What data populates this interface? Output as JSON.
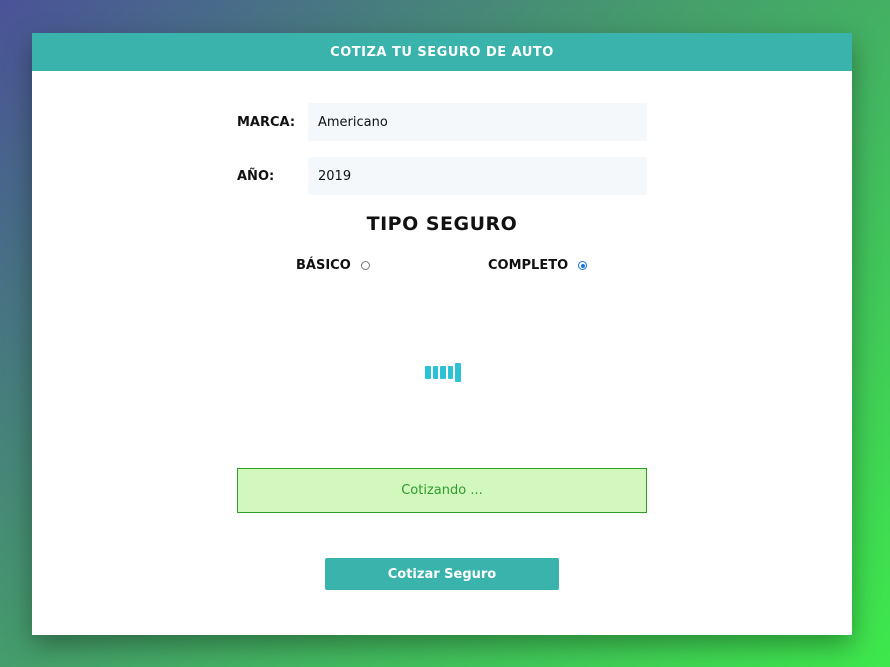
{
  "header": {
    "title": "COTIZA TU SEGURO DE AUTO"
  },
  "form": {
    "marca": {
      "label": "MARCA:",
      "value": "Americano"
    },
    "anio": {
      "label": "AÑO:",
      "value": "2019"
    }
  },
  "tipo_seguro": {
    "title": "TIPO SEGURO",
    "options": [
      {
        "label": "BÁSICO",
        "checked": false
      },
      {
        "label": "COMPLETO",
        "checked": true
      }
    ]
  },
  "status": {
    "message": "Cotizando ..."
  },
  "submit": {
    "label": "Cotizar Seguro"
  },
  "colors": {
    "accent": "#39b3ac",
    "alert_bg": "#d3f8be",
    "alert_text": "#2e9b2e",
    "spinner": "#2bc2d6"
  }
}
